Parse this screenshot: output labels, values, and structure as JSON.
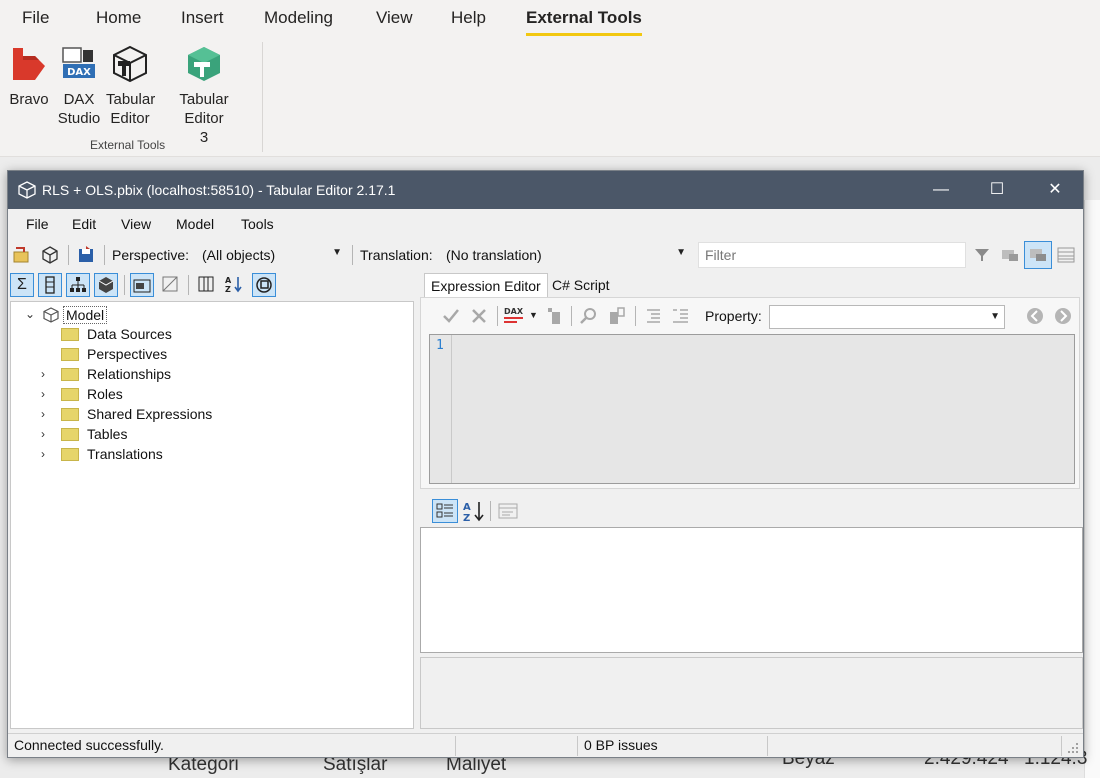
{
  "pbi": {
    "tabs": [
      "File",
      "Home",
      "Insert",
      "Modeling",
      "View",
      "Help",
      "External Tools"
    ],
    "tools": [
      {
        "line1": "Bravo",
        "line2": ""
      },
      {
        "line1": "DAX",
        "line2": "Studio",
        "icon_text": "DAX"
      },
      {
        "line1": "Tabular",
        "line2": "Editor"
      },
      {
        "line1": "Tabular Editor",
        "line2": "3"
      }
    ],
    "group_label": "External Tools"
  },
  "background": {
    "col1": "Kategori",
    "col2": "Satışlar",
    "col3": "Maliyet",
    "cell1": "Beyaz",
    "cell2": "2.429.424",
    "cell3": "1.124.3"
  },
  "window": {
    "title": "RLS + OLS.pbix (localhost:58510) - Tabular Editor 2.17.1",
    "minimize": "—",
    "maximize": "☐",
    "close": "✕",
    "menu": [
      "File",
      "Edit",
      "View",
      "Model",
      "Tools"
    ],
    "toolbar": {
      "perspective_label": "Perspective:",
      "perspective_value": "(All objects)",
      "translation_label": "Translation:",
      "translation_value": "(No translation)",
      "filter_placeholder": "Filter"
    },
    "tree": {
      "root": "Model",
      "items": [
        {
          "label": "Data Sources",
          "expandable": false
        },
        {
          "label": "Perspectives",
          "expandable": false
        },
        {
          "label": "Relationships",
          "expandable": true
        },
        {
          "label": "Roles",
          "expandable": true
        },
        {
          "label": "Shared Expressions",
          "expandable": true
        },
        {
          "label": "Tables",
          "expandable": true
        },
        {
          "label": "Translations",
          "expandable": true
        }
      ]
    },
    "tabs": [
      "Expression Editor",
      "C# Script"
    ],
    "expression": {
      "property_label": "Property:",
      "dax_label": "DAX",
      "line_number": "1"
    },
    "status": {
      "message": "Connected successfully.",
      "bp_issues": "0 BP issues"
    }
  },
  "colors": {
    "titlebar": "#4b5768",
    "active_tab_underline": "#f2c811",
    "selected_tool_bg": "#cce4f7",
    "folder": "#e6d56a"
  }
}
